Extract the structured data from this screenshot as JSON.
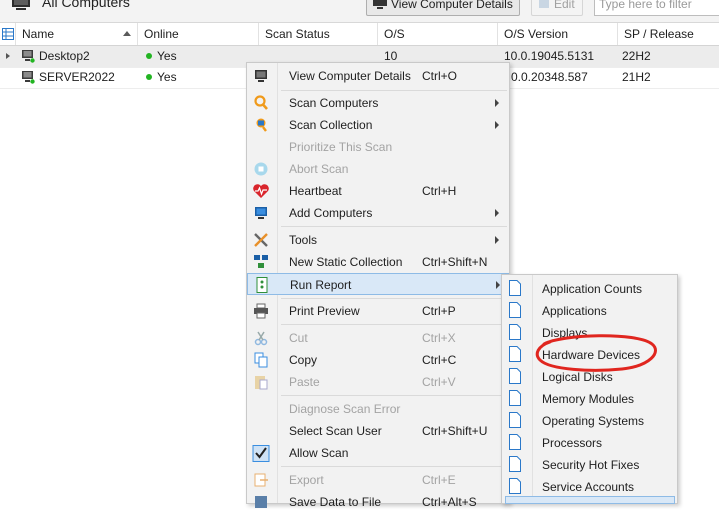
{
  "app": {
    "title": "All Computers",
    "toolbar": {
      "view_details": "View Computer Details",
      "edit": "Edit",
      "filter_placeholder": "Type here to filter"
    }
  },
  "table": {
    "columns": [
      "Name",
      "Online",
      "Scan Status",
      "O/S",
      "O/S Version",
      "SP / Release"
    ],
    "rows": [
      {
        "name": "Desktop2",
        "online": "Yes",
        "scan_status": "",
        "os": "10",
        "os_version": "10.0.19045.5131",
        "release": "22H2"
      },
      {
        "name": "SERVER2022",
        "online": "Yes",
        "scan_status": "",
        "os": "",
        "os_version": "0.0.20348.587",
        "release": "21H2"
      }
    ]
  },
  "context_menu": {
    "items": [
      {
        "label": "View Computer Details",
        "shortcut": "Ctrl+O",
        "icon": "monitor-icon"
      },
      {
        "label": "Scan Computers",
        "shortcut": "",
        "icon": "magnifier-icon"
      },
      {
        "label": "Scan Collection",
        "shortcut": "",
        "icon": "scan-collection-icon"
      },
      {
        "label": "Prioritize This Scan",
        "shortcut": "",
        "icon": ""
      },
      {
        "label": "Abort Scan",
        "shortcut": "",
        "icon": "abort-icon"
      },
      {
        "label": "Heartbeat",
        "shortcut": "Ctrl+H",
        "icon": "heart-icon"
      },
      {
        "label": "Add Computers",
        "shortcut": "",
        "icon": "add-computer-icon"
      },
      {
        "label": "Tools",
        "shortcut": "",
        "icon": "tools-icon"
      },
      {
        "label": "New Static Collection",
        "shortcut": "Ctrl+Shift+N",
        "icon": "collection-icon"
      },
      {
        "label": "Run Report",
        "shortcut": "",
        "icon": "report-icon"
      },
      {
        "label": "Print Preview",
        "shortcut": "Ctrl+P",
        "icon": "printer-icon"
      },
      {
        "label": "Cut",
        "shortcut": "Ctrl+X",
        "icon": "scissors-icon"
      },
      {
        "label": "Copy",
        "shortcut": "Ctrl+C",
        "icon": "copy-icon"
      },
      {
        "label": "Paste",
        "shortcut": "Ctrl+V",
        "icon": "paste-icon"
      },
      {
        "label": "Diagnose Scan Error",
        "shortcut": "",
        "icon": ""
      },
      {
        "label": "Select Scan User",
        "shortcut": "Ctrl+Shift+U",
        "icon": ""
      },
      {
        "label": "Allow Scan",
        "shortcut": "",
        "icon": "checkbox-icon"
      },
      {
        "label": "Export",
        "shortcut": "Ctrl+E",
        "icon": "export-icon"
      },
      {
        "label": "Save Data to File",
        "shortcut": "Ctrl+Alt+S",
        "icon": "save-icon"
      }
    ]
  },
  "report_submenu": {
    "items": [
      "Application Counts",
      "Applications",
      "Displays",
      "Hardware Devices",
      "Logical Disks",
      "Memory Modules",
      "Operating Systems",
      "Processors",
      "Security Hot Fixes",
      "Service Accounts"
    ]
  },
  "colors": {
    "annotation": "#e0261f",
    "accent": "#2a78c9",
    "online_dot": "#22b422",
    "highlight": "#d9e8f7"
  }
}
